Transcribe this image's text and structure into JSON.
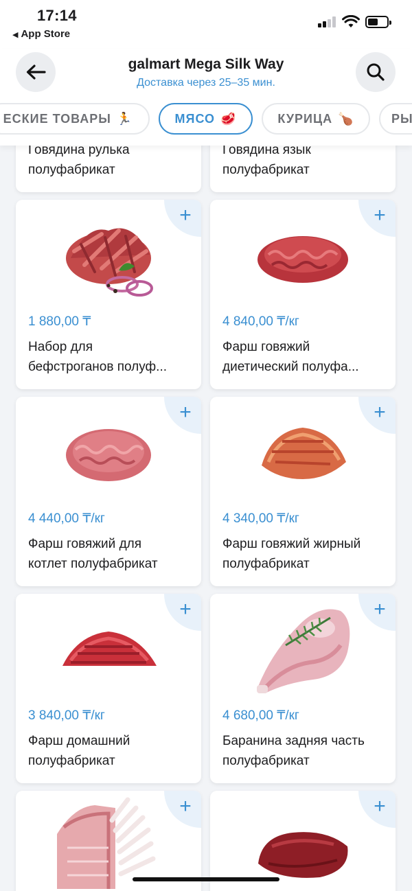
{
  "status_bar": {
    "time": "17:14",
    "back_label": "App Store"
  },
  "header": {
    "store_name": "galmart Mega Silk Way",
    "delivery": "Доставка через 25–35 мин."
  },
  "categories": [
    {
      "label": "ЕСКИЕ ТОВАРЫ",
      "emoji": "🏃",
      "active": false
    },
    {
      "label": "МЯСО",
      "emoji": "🥩",
      "active": true
    },
    {
      "label": "КУРИЦА",
      "emoji": "🍗",
      "active": false
    },
    {
      "label": "РЫ",
      "emoji": "",
      "active": false
    }
  ],
  "top_products": [
    {
      "line1": "Говядина рулька",
      "line2": "полуфабрикат"
    },
    {
      "line1": "Говядина язык",
      "line2": "полуфабрикат"
    }
  ],
  "products": [
    {
      "price": "1 880,00 ₸",
      "line1": "Набор для",
      "line2": "бефстроганов полуф...",
      "image": "beef-strips-image"
    },
    {
      "price": "4 840,00 ₸/кг",
      "line1": "Фарш говяжий",
      "line2": "диетический полуфа...",
      "image": "minced-beef-image"
    },
    {
      "price": "4 440,00 ₸/кг",
      "line1": "Фарш говяжий для",
      "line2": "котлет полуфабрикат",
      "image": "minced-beef-image"
    },
    {
      "price": "4 340,00 ₸/кг",
      "line1": "Фарш говяжий жирный",
      "line2": "полуфабрикат",
      "image": "minced-fat-beef-image"
    },
    {
      "price": "3 840,00 ₸/кг",
      "line1": "Фарш домашний",
      "line2": "полуфабрикат",
      "image": "minced-home-image"
    },
    {
      "price": "4 680,00 ₸/кг",
      "line1": "Баранина задняя часть",
      "line2": "полуфабрикат",
      "image": "lamb-leg-image"
    },
    {
      "price": "",
      "line1": "",
      "line2": "",
      "image": "lamb-rack-image"
    },
    {
      "price": "",
      "line1": "",
      "line2": "",
      "image": "beef-cut-image"
    }
  ],
  "add_button_label": "+",
  "colors": {
    "accent": "#3a8fd1",
    "plus_bg": "#e8f1fa",
    "background": "#f2f4f7"
  }
}
